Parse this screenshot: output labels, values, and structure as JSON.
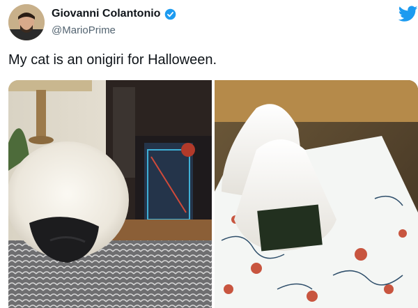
{
  "tweet": {
    "author_name": "Giovanni Colantonio",
    "handle": "@MarioPrime",
    "text": "My cat is an onigiri for Halloween."
  },
  "icons": {
    "verified": "verified-badge-icon",
    "brand": "twitter-bird-icon"
  },
  "colors": {
    "brand": "#1d9bf0",
    "text": "#0f1419",
    "secondary_text": "#536471"
  },
  "media": {
    "images": [
      {
        "depicts": "white-cat-onigiri-costume-photo"
      },
      {
        "depicts": "onigiri-rice-balls-plate-photo"
      }
    ]
  }
}
